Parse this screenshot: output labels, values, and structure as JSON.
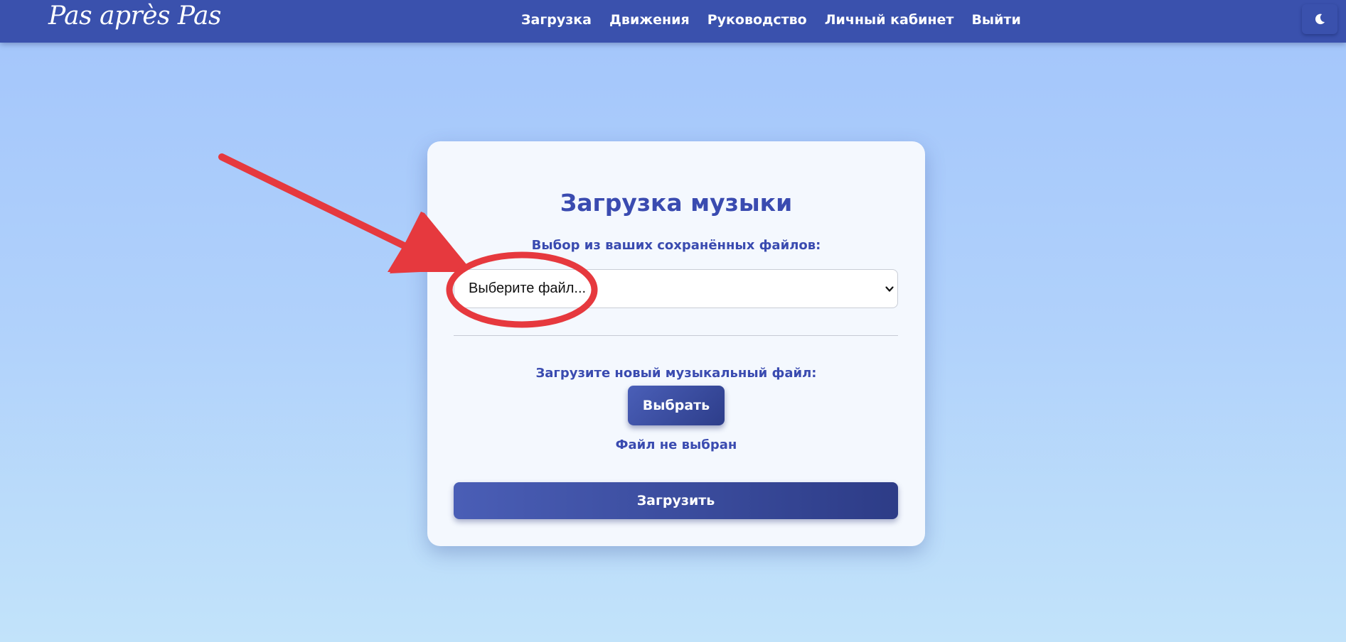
{
  "header": {
    "logo": "Pas après Pas",
    "nav": [
      {
        "label": "Загрузка"
      },
      {
        "label": "Движения"
      },
      {
        "label": "Руководство"
      },
      {
        "label": "Личный кабинет"
      },
      {
        "label": "Выйти"
      }
    ],
    "theme_toggle_icon": "moon-icon"
  },
  "upload_card": {
    "title": "Загрузка музыки",
    "saved_files_label": "Выбор из ваших сохранённых файлов:",
    "file_select": {
      "selected_value": "Выберите файл...",
      "icon": "chevron-down-icon"
    },
    "new_file_label": "Загрузите новый музыкальный файл:",
    "choose_button_label": "Выбрать",
    "file_status": "Файл не выбран",
    "upload_button_label": "Загрузить"
  },
  "annotation": {
    "color": "#e6393e",
    "shapes": [
      "arrow",
      "ellipse"
    ]
  },
  "colors": {
    "navbar": "#3a51ad",
    "accent_text": "#3a4bb0",
    "card_background": "#f4f8fe",
    "button_start": "#4a5eb6",
    "button_end": "#2d3c87"
  }
}
